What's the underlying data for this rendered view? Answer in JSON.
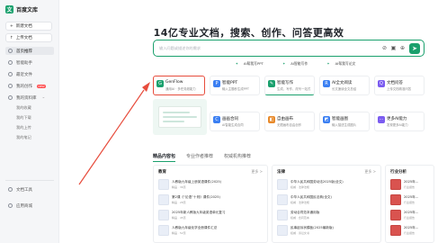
{
  "sidebar": {
    "logo_text": "百度文库",
    "new_doc": "新建文档",
    "upload_doc": "上传文档",
    "items": [
      {
        "label": "首页推荐",
        "icon": "home-icon"
      },
      {
        "label": "智能助手",
        "icon": "assistant-icon"
      },
      {
        "label": "最近文件",
        "icon": "clock-icon"
      },
      {
        "label": "我的创作",
        "icon": "pen-icon",
        "badge": "NEW"
      },
      {
        "label": "我的资料库",
        "icon": "folder-icon"
      }
    ],
    "sub_items": [
      "我的收藏",
      "我的下载",
      "我的上传",
      "我的笔记"
    ],
    "bottom_items": [
      {
        "label": "文档工具",
        "icon": "tool-icon"
      },
      {
        "label": "应用商城",
        "icon": "store-icon"
      }
    ]
  },
  "hero": {
    "title": "14亿专业文档，搜索、创作、问答更高效",
    "search_placeholder": "输入问题或描述你的需求"
  },
  "quick_links": [
    "AI帮我写PPT",
    "AI智能写作",
    "AI帮我写论文"
  ],
  "feature_cards": [
    {
      "title": "GenFlow",
      "subtitle": "通用AI · 多任务超能力",
      "icon": "genflow-icon",
      "color": "#1aa06d"
    },
    {
      "title": "智能PPT",
      "subtitle": "输入主题秒生成PPT",
      "icon": "ppt-icon",
      "color": "#3b7ff2"
    },
    {
      "title": "智能写作",
      "subtitle": "生成、写作、改写一站式",
      "icon": "write-icon",
      "color": "#1aa06d"
    },
    {
      "title": "AI全文阅读",
      "subtitle": "长文速读全文总结",
      "icon": "read-icon",
      "color": "#3b7ff2"
    },
    {
      "title": "文档问答",
      "subtitle": "上传文档精准问答",
      "icon": "qa-icon",
      "color": "#7b5cf0"
    },
    {
      "title": "画画合同",
      "subtitle": "AI智能生成合同",
      "icon": "contract-icon",
      "color": "#3b7ff2"
    },
    {
      "title": "自由画布",
      "subtitle": "无限画布自由创作",
      "icon": "canvas-icon",
      "color": "#e88a2b"
    },
    {
      "title": "智能画图",
      "subtitle": "输入描述生成图片",
      "icon": "draw-icon",
      "color": "#3b7ff2"
    },
    {
      "title": "更多AI能力",
      "subtitle": "发现更多AI能力",
      "icon": "more-icon",
      "color": "#7b5cf0"
    }
  ],
  "content_tabs": [
    "精品内容包",
    "专业作者推荐",
    "权威机构推荐"
  ],
  "columns": [
    {
      "head": "教育",
      "more": "更多 >",
      "rows": [
        {
          "title": "人教版九年级上册英语课件(2025)",
          "meta": "精品 · 36页"
        },
        {
          "title": "第2课《“论语”十则》课件(2025)",
          "meta": "精品 · 28页"
        },
        {
          "title": "2025年新人教版九年级英语单元复习",
          "meta": "精品 · 45页"
        },
        {
          "title": "人教版九年级化学全册课件汇总",
          "meta": "精品 · 52页"
        }
      ]
    },
    {
      "head": "法律",
      "more": "更多 >",
      "rows": [
        {
          "title": "中华人民共和国劳动法2025版(全文)",
          "meta": "权威 · 法律法规"
        },
        {
          "title": "中华人民共和国民法典(全文)",
          "meta": "权威 · 法律法规"
        },
        {
          "title": "劳动合同范本通用版",
          "meta": "权威 · 合同范本"
        },
        {
          "title": "民事起诉状模板(2025最新版)",
          "meta": "权威 · 诉讼文书"
        }
      ]
    },
    {
      "head": "行业分析",
      "more": "",
      "rows": [
        {
          "title": "2025年...",
          "meta": "行业报告"
        },
        {
          "title": "2025年...",
          "meta": "行业报告"
        },
        {
          "title": "2025年...",
          "meta": "行业报告"
        },
        {
          "title": "2025年...",
          "meta": "行业报告"
        }
      ]
    }
  ]
}
